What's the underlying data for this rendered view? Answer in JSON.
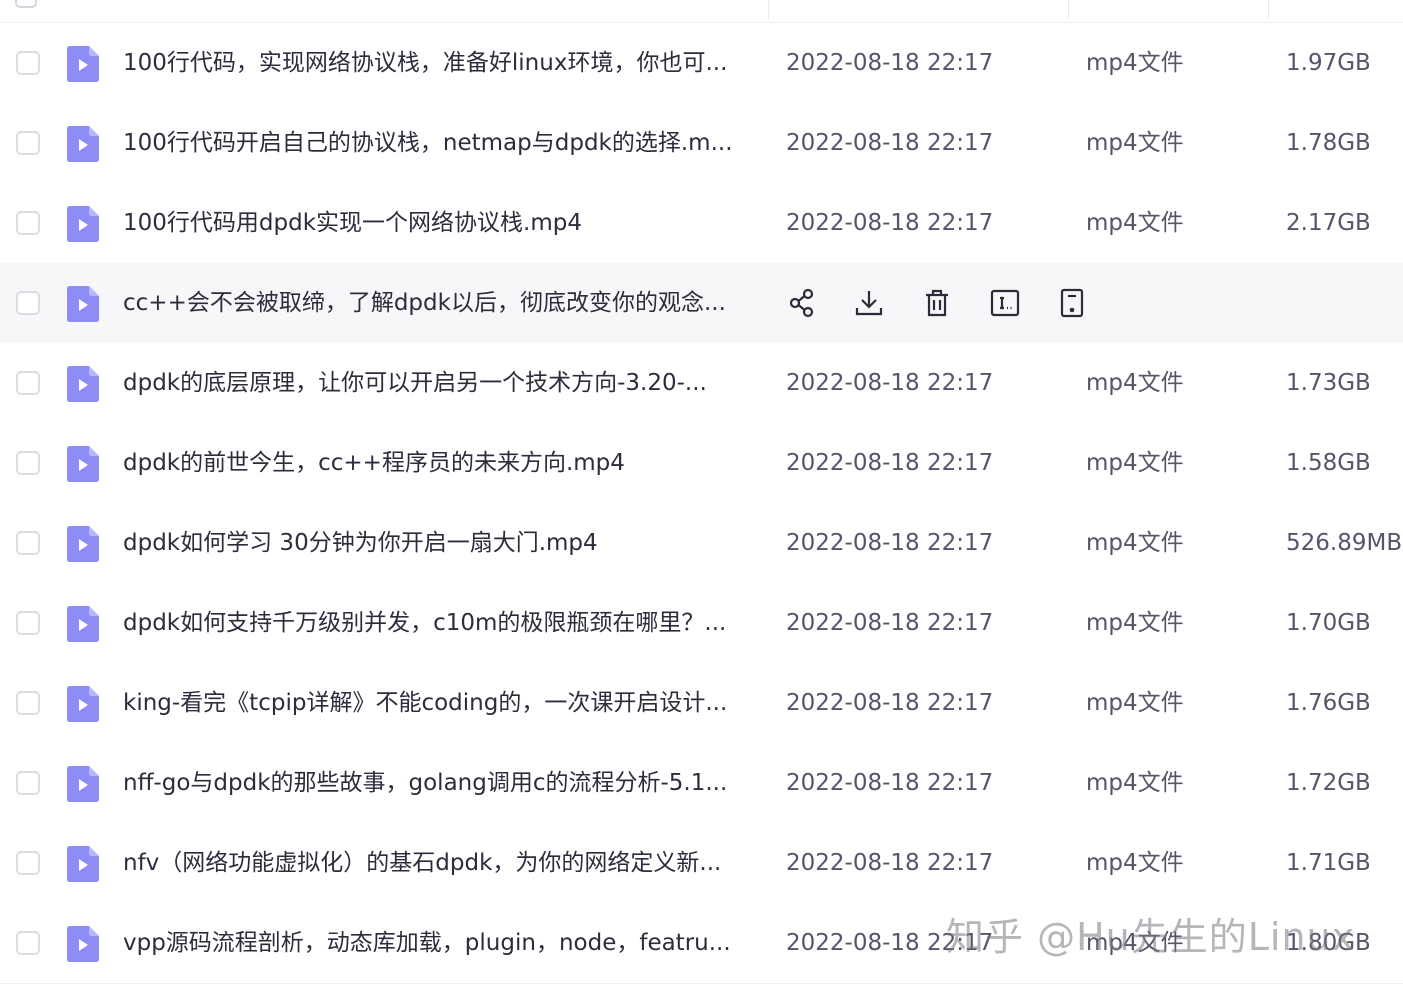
{
  "files": [
    {
      "name": "100行代码，实现网络协议栈，准备好linux环境，你也可...",
      "date": "2022-08-18 22:17",
      "type": "mp4文件",
      "size": "1.97GB"
    },
    {
      "name": "100行代码开启自己的协议栈，netmap与dpdk的选择.m...",
      "date": "2022-08-18 22:17",
      "type": "mp4文件",
      "size": "1.78GB"
    },
    {
      "name": "100行代码用dpdk实现一个网络协议栈.mp4",
      "date": "2022-08-18 22:17",
      "type": "mp4文件",
      "size": "2.17GB"
    },
    {
      "name": "cc++会不会被取缔，了解dpdk以后，彻底改变你的观念...",
      "date": "",
      "type": "",
      "size": ""
    },
    {
      "name": "dpdk的底层原理，让你可以开启另一个技术方向-3.20-...",
      "date": "2022-08-18 22:17",
      "type": "mp4文件",
      "size": "1.73GB"
    },
    {
      "name": "dpdk的前世今生，cc++程序员的未来方向.mp4",
      "date": "2022-08-18 22:17",
      "type": "mp4文件",
      "size": "1.58GB"
    },
    {
      "name": "dpdk如何学习 30分钟为你开启一扇大门.mp4",
      "date": "2022-08-18 22:17",
      "type": "mp4文件",
      "size": "526.89MB"
    },
    {
      "name": "dpdk如何支持千万级别并发，c10m的极限瓶颈在哪里？...",
      "date": "2022-08-18 22:17",
      "type": "mp4文件",
      "size": "1.70GB"
    },
    {
      "name": "king-看完《tcpip详解》不能coding的，一次课开启设计...",
      "date": "2022-08-18 22:17",
      "type": "mp4文件",
      "size": "1.76GB"
    },
    {
      "name": "nff-go与dpdk的那些故事，golang调用c的流程分析-5.1...",
      "date": "2022-08-18 22:17",
      "type": "mp4文件",
      "size": "1.72GB"
    },
    {
      "name": "nfv（网络功能虚拟化）的基石dpdk，为你的网络定义新...",
      "date": "2022-08-18 22:17",
      "type": "mp4文件",
      "size": "1.71GB"
    },
    {
      "name": "vpp源码流程剖析，动态库加载，plugin，node，featru...",
      "date": "2022-08-18 22:17",
      "type": "mp4文件",
      "size": "1.80GB"
    }
  ],
  "hovered_row_index": 3,
  "row_actions": [
    "share-icon",
    "download-icon",
    "delete-icon",
    "rename-icon",
    "more-icon"
  ],
  "icons": {
    "file": "video-file-icon"
  },
  "colors": {
    "file_icon": "#8f8df5",
    "file_icon_fold": "#b9b8fb",
    "hover_row": "#f7f7f9",
    "text_primary": "#2c2c3c",
    "text_secondary": "#55556a"
  },
  "watermark": "知乎 @Hu先生的Linux"
}
